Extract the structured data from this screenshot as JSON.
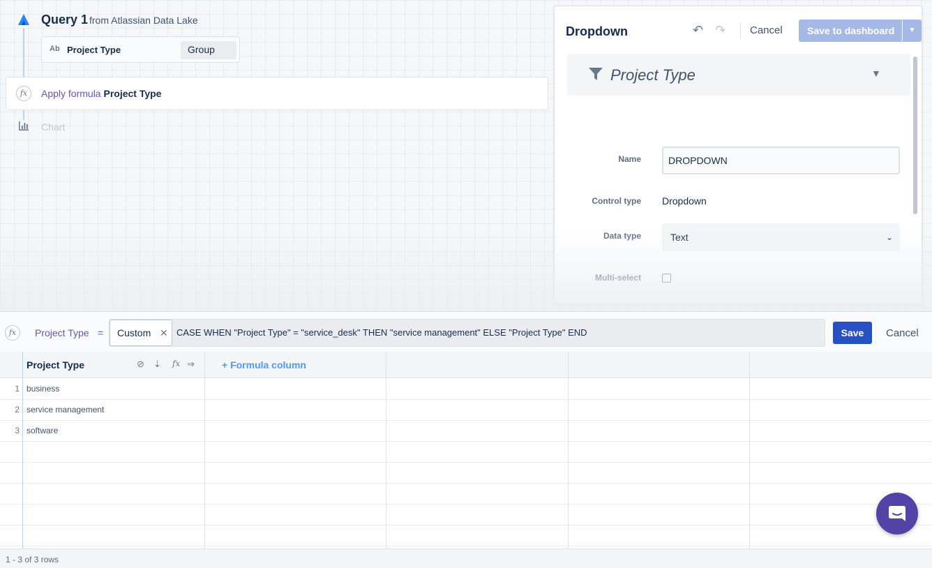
{
  "pipeline": {
    "query_title": "Query 1",
    "query_from": "from Atlassian Data Lake",
    "group_step": {
      "type_badge": "Ab",
      "field": "Project Type",
      "op": "Group"
    },
    "formula_step": {
      "label": "Apply formula",
      "field": "Project Type"
    },
    "chart_step": {
      "label": "Chart"
    }
  },
  "panel": {
    "title": "Dropdown",
    "cancel_label": "Cancel",
    "save_label": "Save to dashboard",
    "filter_title": "Project Type",
    "fields": {
      "name_label": "Name",
      "name_value": "DROPDOWN",
      "control_type_label": "Control type",
      "control_type_value": "Dropdown",
      "data_type_label": "Data type",
      "data_type_value": "Text",
      "multi_select_label": "Multi-select",
      "multi_select_checked": false
    }
  },
  "formula_bar": {
    "column_name": "Project Type",
    "equals": "=",
    "mode_tag": "Custom",
    "expression": "CASE WHEN \"Project Type\" = \"service_desk\" THEN \"service management\" ELSE \"Project Type\" END",
    "save_label": "Save",
    "cancel_label": "Cancel"
  },
  "table": {
    "columns": [
      "Project Type"
    ],
    "add_column_label": "+ Formula column",
    "rows": [
      {
        "num": "1",
        "value": "business"
      },
      {
        "num": "2",
        "value": "service management"
      },
      {
        "num": "3",
        "value": "software"
      }
    ]
  },
  "footer": {
    "row_count": "1 - 3 of 3 rows"
  },
  "colors": {
    "accent": "#2650c4",
    "formula_purple": "#6554c0",
    "link_blue": "#4c9aff",
    "chat": "#5443a7"
  }
}
